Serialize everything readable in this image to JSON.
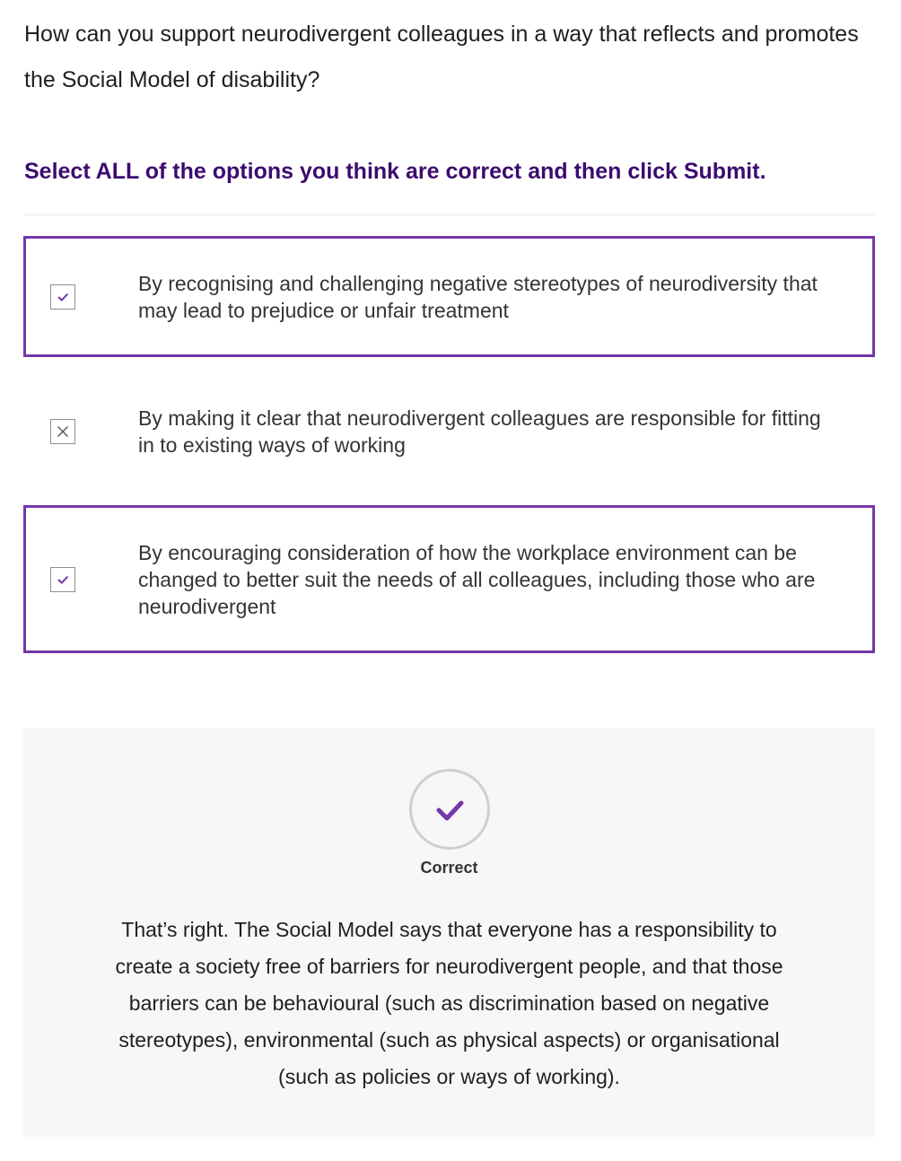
{
  "question": "How can you support neurodivergent colleagues in a way that reflects and promotes the Social Model of disability?",
  "instruction": "Select ALL of the options you think are correct and then click Submit.",
  "options": [
    {
      "label": "By recognising and challenging negative stereotypes of neurodiversity that may lead to prejudice or unfair treatment",
      "state": "checked",
      "icon": "check-icon"
    },
    {
      "label": "By making it clear that neurodivergent colleagues are responsible for fitting in to existing ways of working",
      "state": "unchecked",
      "icon": "cross-icon"
    },
    {
      "label": "By encouraging consideration of how the workplace environment can be changed to better suit the needs of all colleagues, including those who are neurodivergent",
      "state": "checked",
      "icon": "check-icon"
    }
  ],
  "feedback": {
    "status_label": "Correct",
    "status_icon": "check-circle-icon",
    "message": "That’s right. The Social Model says that everyone has a responsibility to create a society free of barriers for neurodivergent people, and that those barriers can be behavioural (such as discrimination based on negative stereotypes), environmental (such as physical aspects) or organisational (such as policies or ways of working)."
  },
  "colors": {
    "accent": "#7637a9",
    "instruction_text": "#3c0c6e",
    "feedback_background": "#f7f7f7"
  }
}
